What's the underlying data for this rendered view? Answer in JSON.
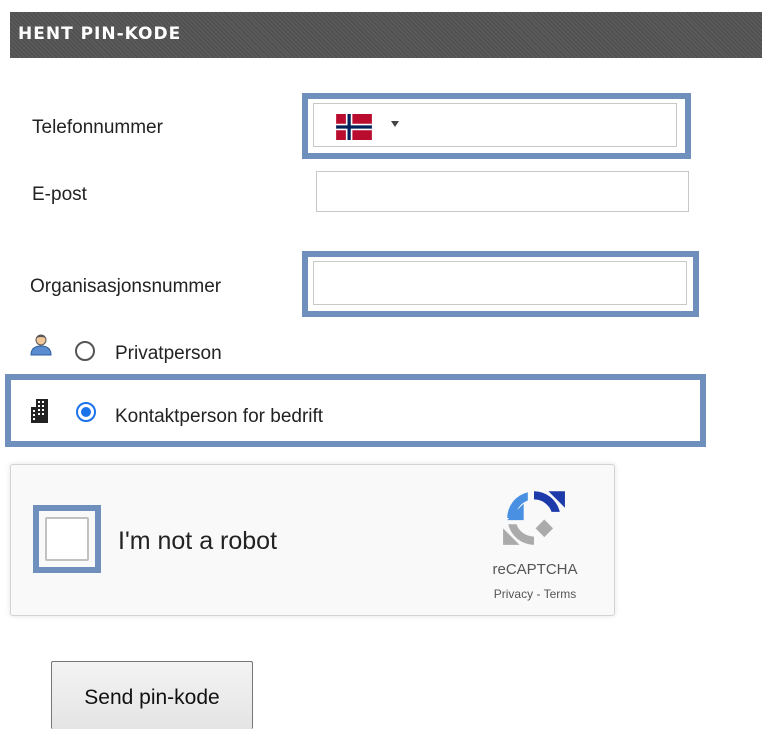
{
  "header": {
    "title": "HENT PIN-KODE"
  },
  "form": {
    "phone": {
      "label": "Telefonnummer",
      "country_flag": "norway-flag-icon",
      "value": ""
    },
    "email": {
      "label": "E-post",
      "value": ""
    },
    "org_number": {
      "label": "Organisasjonsnummer",
      "value": ""
    },
    "user_type": {
      "options": [
        {
          "label": "Privatperson",
          "icon": "person-icon",
          "checked": false
        },
        {
          "label": "Kontaktperson for bedrift",
          "icon": "building-icon",
          "checked": true
        }
      ]
    }
  },
  "captcha": {
    "label": "I'm not a robot",
    "brand": "reCAPTCHA",
    "privacy": "Privacy",
    "separator": " - ",
    "terms": "Terms",
    "checked": false
  },
  "actions": {
    "send_label": "Send pin-kode"
  },
  "colors": {
    "highlight": "#6f8fbd",
    "header_bg": "#555555",
    "radio_checked": "#1a73e8"
  }
}
